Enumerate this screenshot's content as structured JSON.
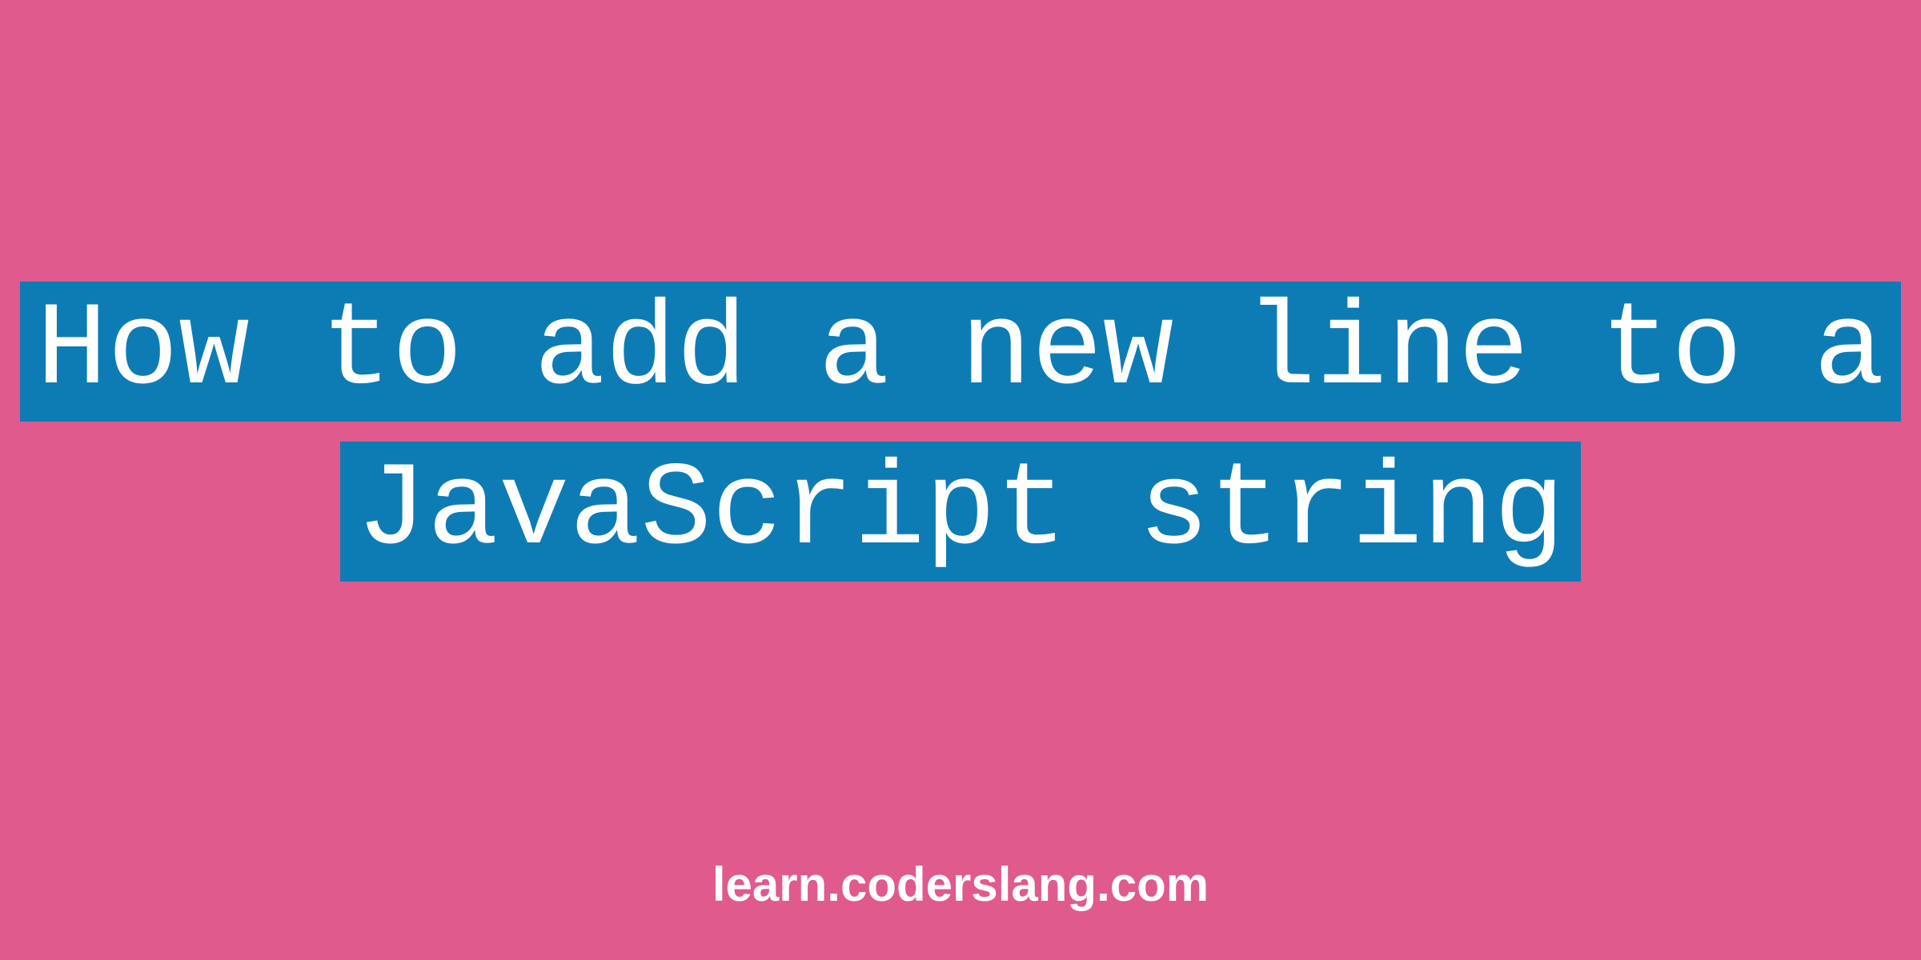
{
  "title": {
    "line1": "How to add a new line to a",
    "line2": "JavaScript string"
  },
  "footer": "learn.coderslang.com",
  "colors": {
    "background": "#e05a8e",
    "highlight": "#0d7cb5",
    "text": "#ffffff"
  }
}
